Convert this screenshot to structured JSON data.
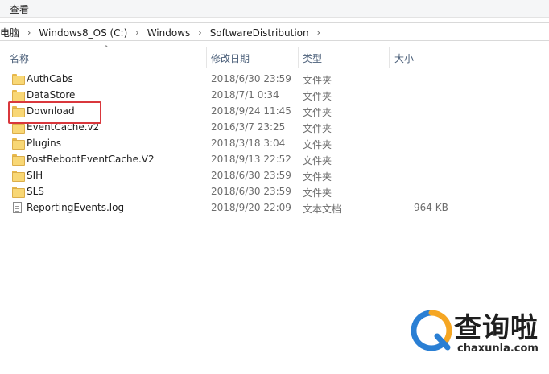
{
  "ribbon": {
    "tab_view": "查看"
  },
  "address": {
    "crumbs": [
      "电脑",
      "Windows8_OS (C:)",
      "Windows",
      "SoftwareDistribution"
    ],
    "separator": "›"
  },
  "columns": {
    "name": "名称",
    "date": "修改日期",
    "type": "类型",
    "size": "大小"
  },
  "sort_indicator": "^",
  "files": [
    {
      "name": "AuthCabs",
      "date": "2018/6/30 23:59",
      "type": "文件夹",
      "size": "",
      "icon": "folder-icon"
    },
    {
      "name": "DataStore",
      "date": "2018/7/1 0:34",
      "type": "文件夹",
      "size": "",
      "icon": "folder-icon"
    },
    {
      "name": "Download",
      "date": "2018/9/24 11:45",
      "type": "文件夹",
      "size": "",
      "icon": "folder-icon",
      "highlighted": true,
      "highlight_color": "#d9373c"
    },
    {
      "name": "EventCache.v2",
      "date": "2016/3/7 23:25",
      "type": "文件夹",
      "size": "",
      "icon": "folder-icon"
    },
    {
      "name": "Plugins",
      "date": "2018/3/18 3:04",
      "type": "文件夹",
      "size": "",
      "icon": "folder-icon"
    },
    {
      "name": "PostRebootEventCache.V2",
      "date": "2018/9/13 22:52",
      "type": "文件夹",
      "size": "",
      "icon": "folder-icon"
    },
    {
      "name": "SIH",
      "date": "2018/6/30 23:59",
      "type": "文件夹",
      "size": "",
      "icon": "folder-icon"
    },
    {
      "name": "SLS",
      "date": "2018/6/30 23:59",
      "type": "文件夹",
      "size": "",
      "icon": "folder-icon"
    },
    {
      "name": "ReportingEvents.log",
      "date": "2018/9/20 22:09",
      "type": "文本文档",
      "size": "964 KB",
      "icon": "file-icon"
    }
  ],
  "watermark": {
    "title": "查询啦",
    "subtitle": "chaxunla.com",
    "colors": {
      "blue": "#2a7fd4",
      "orange": "#f5a623"
    }
  }
}
